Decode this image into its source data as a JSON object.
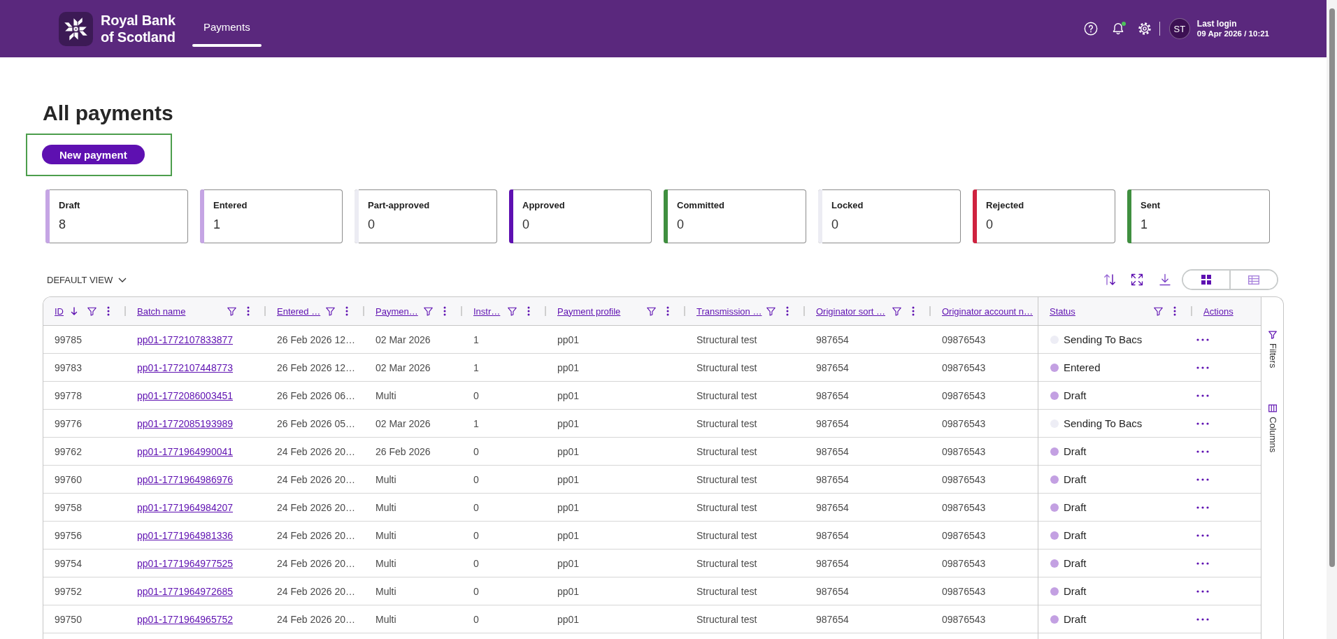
{
  "header": {
    "brand_lines": [
      "Royal Bank",
      "of Scotland"
    ],
    "tabs": [
      {
        "label": "Payments",
        "selected": true
      }
    ],
    "notifications_unread": true,
    "avatar_initials": "ST",
    "last_login_label": "Last login",
    "last_login_time": "09 Apr 2026 / 10:21"
  },
  "page_title": "All payments",
  "new_payment_button": {
    "label": "New payment",
    "highlighted": true
  },
  "status_cards": [
    {
      "label": "Draft",
      "count": "8",
      "color": "#c5a5e4"
    },
    {
      "label": "Entered",
      "count": "1",
      "color": "#c5a5e4"
    },
    {
      "label": "Part-approved",
      "count": "0",
      "color": "#ececf3"
    },
    {
      "label": "Approved",
      "count": "0",
      "color": "#5e10b1"
    },
    {
      "label": "Committed",
      "count": "0",
      "color": "#3f8f3f"
    },
    {
      "label": "Locked",
      "count": "0",
      "color": "#ececf3"
    },
    {
      "label": "Rejected",
      "count": "0",
      "color": "#cf223f"
    },
    {
      "label": "Sent",
      "count": "1",
      "color": "#3f8f3f"
    }
  ],
  "view_menu": {
    "label": "DEFAULT VIEW"
  },
  "view_toggle": [
    {
      "kind": "grid",
      "selected": true
    },
    {
      "kind": "list",
      "selected": false
    }
  ],
  "table": {
    "columns": [
      {
        "label": "ID",
        "sorted_descending": true,
        "filter_button": true,
        "menu_button": true
      },
      {
        "label": "Batch name",
        "filter_button": true,
        "menu_button": true
      },
      {
        "label": "Entered …",
        "filter_button": true,
        "menu_button": true
      },
      {
        "label": "Paymen…",
        "filter_button": true,
        "menu_button": true
      },
      {
        "label": "Instr…",
        "filter_button": true,
        "menu_button": true
      },
      {
        "label": "Payment profile",
        "filter_button": true,
        "menu_button": true
      },
      {
        "label": "Transmission …",
        "filter_button": true,
        "menu_button": true
      },
      {
        "label": "Originator sort …",
        "filter_button": true,
        "menu_button": true
      },
      {
        "label": "Originator account n…",
        "filter_button": false,
        "menu_button": false
      },
      {
        "label": "Status",
        "filter_button": true,
        "menu_button": true
      },
      {
        "label": "Actions",
        "filter_button": false,
        "menu_button": false
      }
    ],
    "rows": [
      {
        "id": "99785",
        "batch_name": "pp01-1772107833877",
        "entered": "26 Feb 2026 12…",
        "payment_date": "02 Mar 2026",
        "instructions": "1",
        "profile": "pp01",
        "transmission": "Structural test",
        "originator_sort": "987654",
        "originator_account": "09876543",
        "status": {
          "label": "Sending To Bacs",
          "color": "#ededf5"
        }
      },
      {
        "id": "99783",
        "batch_name": "pp01-1772107448773",
        "entered": "26 Feb 2026 12…",
        "payment_date": "02 Mar 2026",
        "instructions": "1",
        "profile": "pp01",
        "transmission": "Structural test",
        "originator_sort": "987654",
        "originator_account": "09876543",
        "status": {
          "label": "Entered",
          "color": "#c3a0e2"
        }
      },
      {
        "id": "99778",
        "batch_name": "pp01-1772086003451",
        "entered": "26 Feb 2026 06…",
        "payment_date": "Multi",
        "instructions": "0",
        "profile": "pp01",
        "transmission": "Structural test",
        "originator_sort": "987654",
        "originator_account": "09876543",
        "status": {
          "label": "Draft",
          "color": "#c3a0e2"
        }
      },
      {
        "id": "99776",
        "batch_name": "pp01-1772085193989",
        "entered": "26 Feb 2026 05…",
        "payment_date": "02 Mar 2026",
        "instructions": "1",
        "profile": "pp01",
        "transmission": "Structural test",
        "originator_sort": "987654",
        "originator_account": "09876543",
        "status": {
          "label": "Sending To Bacs",
          "color": "#ededf5"
        }
      },
      {
        "id": "99762",
        "batch_name": "pp01-1771964990041",
        "entered": "24 Feb 2026 20…",
        "payment_date": "26 Feb 2026",
        "instructions": "0",
        "profile": "pp01",
        "transmission": "Structural test",
        "originator_sort": "987654",
        "originator_account": "09876543",
        "status": {
          "label": "Draft",
          "color": "#c3a0e2"
        }
      },
      {
        "id": "99760",
        "batch_name": "pp01-1771964986976",
        "entered": "24 Feb 2026 20…",
        "payment_date": "Multi",
        "instructions": "0",
        "profile": "pp01",
        "transmission": "Structural test",
        "originator_sort": "987654",
        "originator_account": "09876543",
        "status": {
          "label": "Draft",
          "color": "#c3a0e2"
        }
      },
      {
        "id": "99758",
        "batch_name": "pp01-1771964984207",
        "entered": "24 Feb 2026 20…",
        "payment_date": "Multi",
        "instructions": "0",
        "profile": "pp01",
        "transmission": "Structural test",
        "originator_sort": "987654",
        "originator_account": "09876543",
        "status": {
          "label": "Draft",
          "color": "#c3a0e2"
        }
      },
      {
        "id": "99756",
        "batch_name": "pp01-1771964981336",
        "entered": "24 Feb 2026 20…",
        "payment_date": "Multi",
        "instructions": "0",
        "profile": "pp01",
        "transmission": "Structural test",
        "originator_sort": "987654",
        "originator_account": "09876543",
        "status": {
          "label": "Draft",
          "color": "#c3a0e2"
        }
      },
      {
        "id": "99754",
        "batch_name": "pp01-1771964977525",
        "entered": "24 Feb 2026 20…",
        "payment_date": "Multi",
        "instructions": "0",
        "profile": "pp01",
        "transmission": "Structural test",
        "originator_sort": "987654",
        "originator_account": "09876543",
        "status": {
          "label": "Draft",
          "color": "#c3a0e2"
        }
      },
      {
        "id": "99752",
        "batch_name": "pp01-1771964972685",
        "entered": "24 Feb 2026 20…",
        "payment_date": "Multi",
        "instructions": "0",
        "profile": "pp01",
        "transmission": "Structural test",
        "originator_sort": "987654",
        "originator_account": "09876543",
        "status": {
          "label": "Draft",
          "color": "#c3a0e2"
        }
      },
      {
        "id": "99750",
        "batch_name": "pp01-1771964965752",
        "entered": "24 Feb 2026 20…",
        "payment_date": "Multi",
        "instructions": "0",
        "profile": "pp01",
        "transmission": "Structural test",
        "originator_sort": "987654",
        "originator_account": "09876543",
        "status": {
          "label": "Draft",
          "color": "#c3a0e2"
        }
      }
    ]
  },
  "side_panel": [
    {
      "kind": "filters",
      "label": "Filters"
    },
    {
      "kind": "columns",
      "label": "Columns"
    }
  ]
}
